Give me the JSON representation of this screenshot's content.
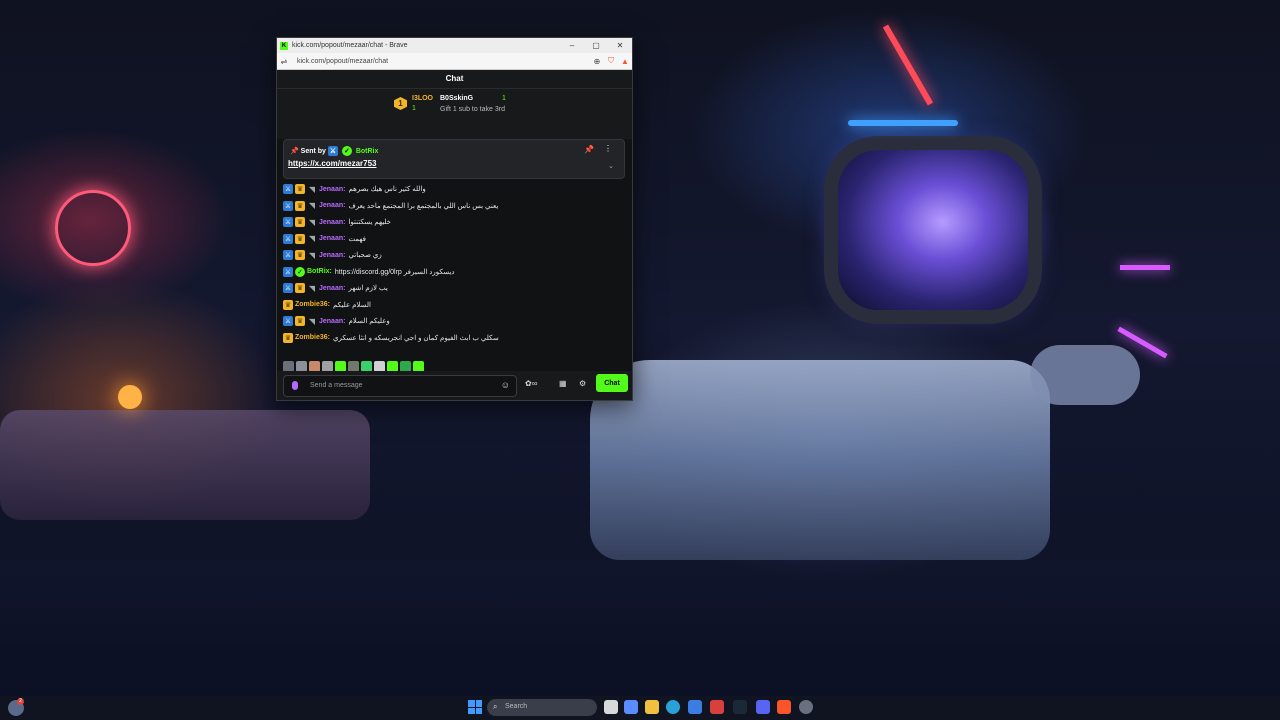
{
  "browser": {
    "title": "kick.com/popout/mezaar/chat - Brave",
    "url": "kick.com/popout/mezaar/chat",
    "window_controls": [
      "–",
      "▢",
      "✕"
    ]
  },
  "chat": {
    "header": "Chat",
    "leaderboard": {
      "rank": "1",
      "user1": "I3LOO",
      "user1_count": "1",
      "user2": "B0SskinG",
      "user2_count": "1",
      "gift_text": "Gift 1 sub to take 3rd"
    },
    "pinned": {
      "sent_by_label": "Sent by",
      "sender": "BotRix",
      "link": "https://x.com/mezar753"
    },
    "messages": [
      {
        "user": "Jenaan:",
        "text": "والله كثير ناس هيك بصرهم",
        "color": "#b86bff",
        "badges": [
          "mod",
          "crown",
          "wave"
        ]
      },
      {
        "user": "Jenaan:",
        "text": "يعني بس ناس اللي بالمجتمع برا المجتمع ماحد يعرف",
        "color": "#b86bff",
        "badges": [
          "mod",
          "crown",
          "wave"
        ]
      },
      {
        "user": "Jenaan:",
        "text": "خليهم يسكتنتوا",
        "color": "#b86bff",
        "badges": [
          "mod",
          "crown",
          "wave"
        ]
      },
      {
        "user": "Jenaan:",
        "text": "فهمت",
        "color": "#b86bff",
        "badges": [
          "mod",
          "crown",
          "wave"
        ]
      },
      {
        "user": "Jenaan:",
        "text": "زي صحباتي",
        "color": "#b86bff",
        "badges": [
          "mod",
          "crown",
          "wave"
        ]
      },
      {
        "user": "BotRix:",
        "text": "https://discord.gg/0lrp ديسكورد السيرفر",
        "color": "#53fc18",
        "badges": [
          "mod",
          "bot"
        ]
      },
      {
        "user": "Jenaan:",
        "text": "يب لازم اشهر",
        "color": "#b86bff",
        "badges": [
          "mod",
          "crown",
          "wave"
        ]
      },
      {
        "user": "Zombie36:",
        "text": "السلام عليكم",
        "color": "#f3b52a",
        "badges": [
          "crown"
        ]
      },
      {
        "user": "Jenaan:",
        "text": "وعليكم السلام",
        "color": "#b86bff",
        "badges": [
          "mod",
          "crown",
          "wave"
        ]
      },
      {
        "user": "Zombie36:",
        "text": "سكلي ب ابث الفيوم كمان و اجي انجريسكه و انثا عسكري",
        "color": "#f3b52a",
        "badges": [
          "crown"
        ]
      }
    ],
    "emote_colors": [
      "#6b6f7a",
      "#8a8f9a",
      "#c98a6b",
      "#a0a0a0",
      "#53fc18",
      "#6f7a6b",
      "#3bd16a",
      "#d0d0d0",
      "#53fc18",
      "#2ea84a",
      "#53fc18"
    ],
    "input_placeholder": "Send a message",
    "send_button": "Chat"
  },
  "taskbar": {
    "notification_count": "2",
    "search_placeholder": "Search"
  }
}
